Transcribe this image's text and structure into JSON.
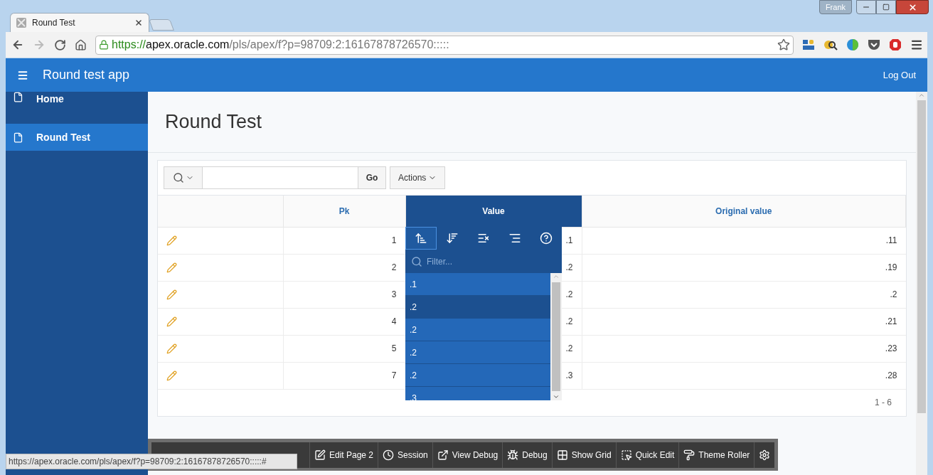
{
  "browser": {
    "user": "Frank",
    "tab_title": "Round Test",
    "url": {
      "scheme": "https://",
      "host": "apex.oracle.com",
      "path": "/pls/apex/f?p=98709:2:16167878726570:::::"
    },
    "status_url": "https://apex.oracle.com/pls/apex/f?p=98709:2:16167878726570:::::#"
  },
  "app": {
    "title": "Round test app",
    "logout": "Log Out"
  },
  "sidebar": {
    "items": [
      {
        "label": "Home",
        "selected": false
      },
      {
        "label": "Round Test",
        "selected": true
      }
    ]
  },
  "page": {
    "title": "Round Test"
  },
  "report_toolbar": {
    "go": "Go",
    "actions": "Actions"
  },
  "table": {
    "columns": [
      {
        "label": "Pk",
        "selected": false
      },
      {
        "label": "Value",
        "selected": true
      },
      {
        "label": "Original value",
        "selected": false
      }
    ],
    "rows": [
      {
        "pk": "1",
        "value": ".1",
        "original": ".11"
      },
      {
        "pk": "2",
        "value": ".2",
        "original": ".19"
      },
      {
        "pk": "3",
        "value": ".2",
        "original": ".2"
      },
      {
        "pk": "4",
        "value": ".2",
        "original": ".21"
      },
      {
        "pk": "5",
        "value": ".2",
        "original": ".23"
      },
      {
        "pk": "7",
        "value": ".3",
        "original": ".28"
      }
    ],
    "pagination": "1 - 6"
  },
  "column_menu": {
    "buttons": [
      {
        "kind": "sort_asc",
        "selected": true
      },
      {
        "kind": "sort_desc",
        "selected": false
      },
      {
        "kind": "hide",
        "selected": false
      },
      {
        "kind": "break",
        "selected": false
      },
      {
        "kind": "help",
        "selected": false
      }
    ],
    "filter_placeholder": "Filter...",
    "values": [
      {
        "label": ".1",
        "selected": false
      },
      {
        "label": ".2",
        "selected": true
      },
      {
        "label": ".2",
        "selected": false
      },
      {
        "label": ".2",
        "selected": false
      },
      {
        "label": ".2",
        "selected": false
      },
      {
        "label": ".3",
        "selected": false
      }
    ]
  },
  "developer_toolbar": [
    {
      "kind": "edit",
      "label": "Edit Page 2"
    },
    {
      "kind": "session",
      "label": "Session"
    },
    {
      "kind": "view_debug",
      "label": "View Debug"
    },
    {
      "kind": "debug",
      "label": "Debug"
    },
    {
      "kind": "grid",
      "label": "Show Grid"
    },
    {
      "kind": "quick_edit",
      "label": "Quick Edit"
    },
    {
      "kind": "theme",
      "label": "Theme Roller"
    },
    {
      "kind": "settings"
    }
  ]
}
